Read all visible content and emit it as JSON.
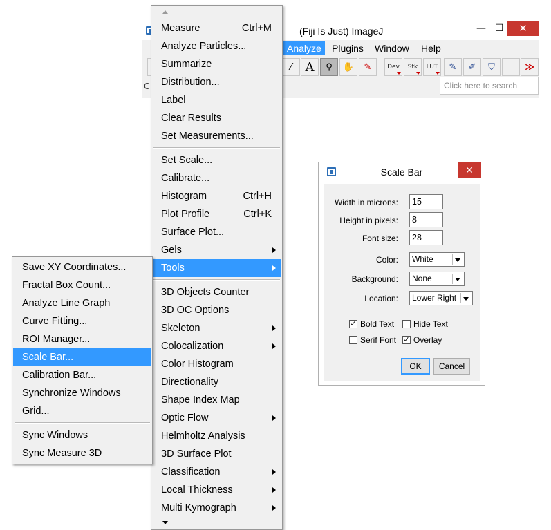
{
  "fiji": {
    "title": "(Fiji Is Just) ImageJ",
    "window_controls": {
      "minimize": "—",
      "maximize": "☐",
      "close": "✕"
    },
    "menubar": [
      {
        "label": "Analyze",
        "active": true
      },
      {
        "label": "Plugins",
        "active": false
      },
      {
        "label": "Window",
        "active": false
      },
      {
        "label": "Help",
        "active": false
      }
    ],
    "toolbar": {
      "wand": "⁄",
      "text": "A",
      "zoom": "⚲",
      "hand": "✋",
      "picker": "✎",
      "dev": "Dev",
      "stk": "Stk",
      "lut": "LUT",
      "pencil": "✎",
      "brush": "✐",
      "bucket": "⛉",
      "more": "≫"
    },
    "status_clip": "C",
    "search_placeholder": "Click here to search"
  },
  "analyze_menu": {
    "items": [
      {
        "label": "Measure",
        "shortcut": "Ctrl+M"
      },
      {
        "label": "Analyze Particles..."
      },
      {
        "label": "Summarize"
      },
      {
        "label": "Distribution..."
      },
      {
        "label": "Label"
      },
      {
        "label": "Clear Results"
      },
      {
        "label": "Set Measurements..."
      },
      {
        "label": "Set Scale..."
      },
      {
        "label": "Calibrate..."
      },
      {
        "label": "Histogram",
        "shortcut": "Ctrl+H"
      },
      {
        "label": "Plot Profile",
        "shortcut": "Ctrl+K"
      },
      {
        "label": "Surface Plot..."
      },
      {
        "label": "Gels",
        "submenu": true
      },
      {
        "label": "Tools",
        "submenu": true,
        "highlighted": true
      },
      {
        "label": "3D Objects Counter"
      },
      {
        "label": "3D OC Options"
      },
      {
        "label": "Skeleton",
        "submenu": true
      },
      {
        "label": "Colocalization",
        "submenu": true
      },
      {
        "label": "Color Histogram"
      },
      {
        "label": "Directionality"
      },
      {
        "label": "Shape Index Map"
      },
      {
        "label": "Optic Flow",
        "submenu": true
      },
      {
        "label": "Helmholtz Analysis"
      },
      {
        "label": "3D Surface Plot"
      },
      {
        "label": "Classification",
        "submenu": true
      },
      {
        "label": "Local Thickness",
        "submenu": true
      },
      {
        "label": "Multi Kymograph",
        "submenu": true
      }
    ]
  },
  "tools_menu": {
    "items": [
      {
        "label": "Save XY Coordinates..."
      },
      {
        "label": "Fractal Box Count..."
      },
      {
        "label": "Analyze Line Graph"
      },
      {
        "label": "Curve Fitting..."
      },
      {
        "label": "ROI Manager..."
      },
      {
        "label": "Scale Bar...",
        "highlighted": true
      },
      {
        "label": "Calibration Bar..."
      },
      {
        "label": "Synchronize Windows"
      },
      {
        "label": "Grid..."
      },
      {
        "label": "Sync Windows"
      },
      {
        "label": "Sync Measure 3D"
      }
    ]
  },
  "scale_bar_dialog": {
    "title": "Scale Bar",
    "close": "✕",
    "width_label": "Width in microns:",
    "width_value": "15",
    "height_label": "Height in pixels:",
    "height_value": "8",
    "font_label": "Font size:",
    "font_value": "28",
    "color_label": "Color:",
    "color_value": "White",
    "background_label": "Background:",
    "background_value": "None",
    "location_label": "Location:",
    "location_value": "Lower Right",
    "bold_text": {
      "label": "Bold Text",
      "checked": true
    },
    "hide_text": {
      "label": "Hide Text",
      "checked": false
    },
    "serif_font": {
      "label": "Serif Font",
      "checked": false
    },
    "overlay": {
      "label": "Overlay",
      "checked": true
    },
    "check_mark": "✓",
    "ok": "OK",
    "cancel": "Cancel"
  },
  "colors": {
    "highlight": "#3399ff",
    "close_red": "#c7372f",
    "menu_bg": "#f0f0f0"
  }
}
